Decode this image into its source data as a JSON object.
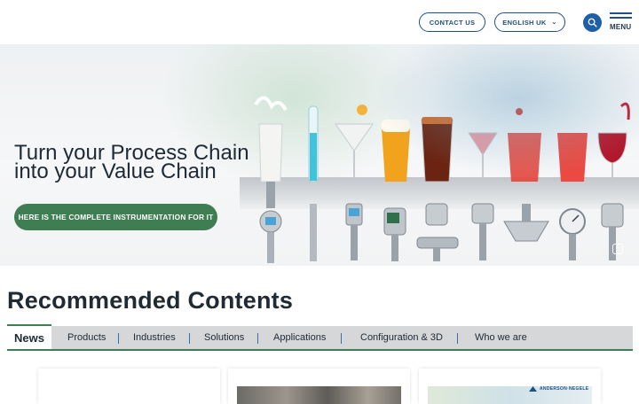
{
  "header": {
    "contact_label": "CONTACT US",
    "language_label": "ENGLISH UK",
    "menu_label": "MENU"
  },
  "hero": {
    "title_line1": "Turn your Process Chain",
    "title_line2": "into your Value Chain",
    "cta_label": "HERE IS THE COMPLETE INSTRUMENTATION FOR IT"
  },
  "recommended": {
    "title": "Recommended Contents",
    "tabs": [
      {
        "label": "News",
        "active": true
      },
      {
        "label": "Products"
      },
      {
        "label": "Industries"
      },
      {
        "label": "Solutions"
      },
      {
        "label": "Applications"
      },
      {
        "label": "Configuration & 3D"
      },
      {
        "label": "Who we are"
      }
    ]
  },
  "cards": [
    {
      "brand": ""
    },
    {
      "brand": ""
    },
    {
      "brand": "ANDERSON·NEGELE"
    }
  ],
  "colors": {
    "brand_blue": "#1f4f86",
    "accent_green": "#3e7e52",
    "tab_bar_bg": "#d6d7d8"
  }
}
